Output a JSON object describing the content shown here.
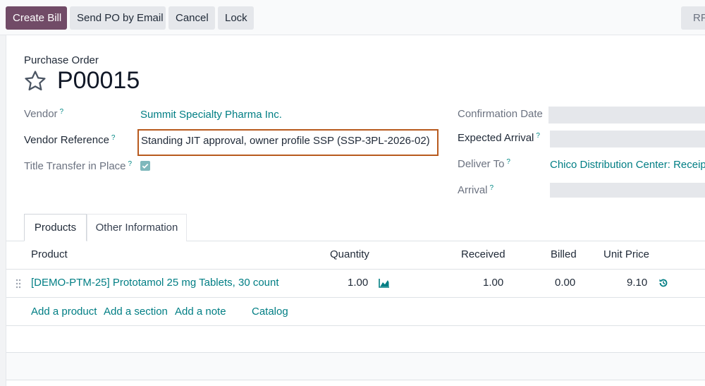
{
  "toolbar": {
    "create_bill": "Create Bill",
    "send_po": "Send PO by Email",
    "cancel": "Cancel",
    "lock": "Lock",
    "rfq_partial": "RF"
  },
  "header": {
    "record_type": "Purchase Order",
    "record_name": "P00015"
  },
  "fields_left": {
    "vendor_label": "Vendor",
    "vendor_value": "Summit Specialty Pharma Inc.",
    "vendor_ref_label": "Vendor Reference",
    "vendor_ref_value": "Standing JIT approval, owner profile SSP (SSP-3PL-2026-02)",
    "title_transfer_label": "Title Transfer in Place",
    "title_transfer_checked": true
  },
  "fields_right": {
    "confirmation_date_label": "Confirmation Date",
    "expected_arrival_label": "Expected Arrival",
    "deliver_to_label": "Deliver To",
    "deliver_to_value": "Chico Distribution Center: Receipts",
    "arrival_label": "Arrival"
  },
  "help_marker": "?",
  "tabs": {
    "products": "Products",
    "other_info": "Other Information"
  },
  "table": {
    "headers": {
      "product": "Product",
      "quantity": "Quantity",
      "received": "Received",
      "billed": "Billed",
      "unit_price": "Unit Price"
    },
    "rows": [
      {
        "product": "[DEMO-PTM-25] Prototamol 25 mg Tablets, 30 count",
        "quantity": "1.00",
        "received": "1.00",
        "billed": "0.00",
        "unit_price": "9.10"
      }
    ],
    "actions": {
      "add_product": "Add a product",
      "add_section": "Add a section",
      "add_note": "Add a note",
      "catalog": "Catalog"
    }
  },
  "colors": {
    "primary": "#714b67",
    "link": "#017e84",
    "highlight_border": "#b85a1e"
  }
}
